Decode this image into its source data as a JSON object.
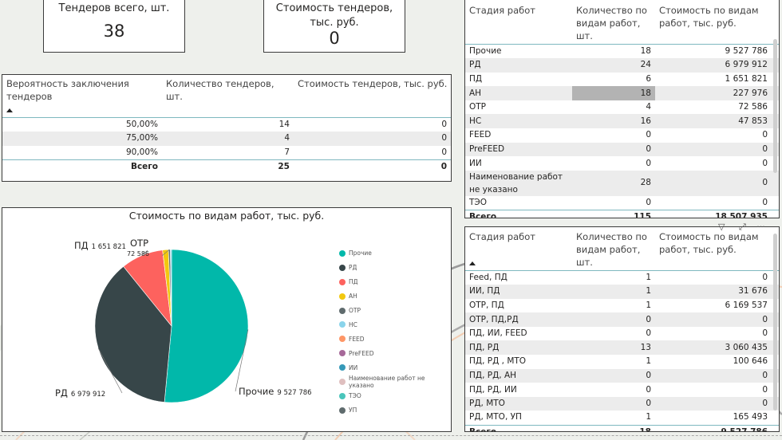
{
  "kpis": {
    "tenders_total": {
      "label": "Тендеров всего, шт.",
      "value": "38"
    },
    "tenders_cost": {
      "label": "Стоимость тендеров, тыс. руб.",
      "value": "0"
    }
  },
  "probability_table": {
    "headers": [
      "Вероятность заключения тендеров",
      "Количество тендеров, шт.",
      "Стоимость тендеров, тыс. руб."
    ],
    "rows": [
      [
        "50,00%",
        "14",
        "0"
      ],
      [
        "75,00%",
        "4",
        "0"
      ],
      [
        "90,00%",
        "7",
        "0"
      ]
    ],
    "total": [
      "Всего",
      "25",
      "0"
    ]
  },
  "stage_table": {
    "headers": [
      "Стадия работ",
      "Количество по видам работ, шт.",
      "Стоимость по видам работ, тыс. руб."
    ],
    "rows": [
      [
        "Прочие",
        "18",
        "9 527 786"
      ],
      [
        "РД",
        "24",
        "6 979 912"
      ],
      [
        "ПД",
        "6",
        "1 651 821"
      ],
      [
        "АН",
        "18",
        "227 976"
      ],
      [
        "ОТР",
        "4",
        "72 586"
      ],
      [
        "НС",
        "16",
        "47 853"
      ],
      [
        "FEED",
        "0",
        "0"
      ],
      [
        "PreFEED",
        "0",
        "0"
      ],
      [
        "ИИ",
        "0",
        "0"
      ],
      [
        "Наименование работ не указано",
        "28",
        "0"
      ],
      [
        "ТЭО",
        "0",
        "0"
      ]
    ],
    "total": [
      "Всего",
      "115",
      "18 507 935"
    ]
  },
  "combo_table": {
    "headers": [
      "Стадия работ",
      "Количество по видам работ, шт.",
      "Стоимость по видам работ, тыс. руб."
    ],
    "rows": [
      [
        "Feed, ПД",
        "1",
        "0"
      ],
      [
        "ИИ, ПД",
        "1",
        "31 676"
      ],
      [
        "ОТР, ПД",
        "1",
        "6 169 537"
      ],
      [
        "ОТР, ПД,РД",
        "0",
        "0"
      ],
      [
        "ПД, ИИ, FEED",
        "0",
        "0"
      ],
      [
        "ПД, РД",
        "13",
        "3 060 435"
      ],
      [
        "ПД, РД , МТО",
        "1",
        "100 646"
      ],
      [
        "ПД, РД, АН",
        "0",
        "0"
      ],
      [
        "ПД, РД, ИИ",
        "0",
        "0"
      ],
      [
        "РД, МТО",
        "0",
        "0"
      ],
      [
        "РД, МТО, УП",
        "1",
        "165 493"
      ]
    ],
    "total": [
      "Всего",
      "18",
      "9 527 786"
    ]
  },
  "chart_data": {
    "type": "pie",
    "title": "Стоимость по видам работ, тыс. руб.",
    "categories": [
      "Прочие",
      "РД",
      "ПД",
      "АН",
      "ОТР",
      "НС",
      "FEED",
      "PreFEED",
      "ИИ",
      "Наименование работ не указано",
      "ТЭО",
      "УП"
    ],
    "values": [
      9527786,
      6979912,
      1651821,
      227976,
      72586,
      47853,
      0,
      0,
      0,
      0,
      0,
      0
    ],
    "colors": [
      "#01b8aa",
      "#374649",
      "#fd625e",
      "#f2c80f",
      "#5f6b6d",
      "#8ad4eb",
      "#fe9666",
      "#a66999",
      "#3599b8",
      "#dfbfbf",
      "#4ac5bb",
      "#5f6b6d"
    ],
    "data_labels": [
      {
        "category": "Прочие",
        "name": "Прочие",
        "value": "9 527 786"
      },
      {
        "category": "РД",
        "name": "РД",
        "value": "6 979 912"
      },
      {
        "category": "ПД",
        "name": "ПД",
        "value": "1 651 821"
      },
      {
        "category": "ОТР",
        "name": "ОТР",
        "value": "72 586"
      }
    ],
    "legend_position": "right"
  },
  "icons": {
    "filter": "filter-icon",
    "focus": "focus-mode-icon",
    "more": "more-options-icon"
  },
  "icon_glyphs": {
    "filter": "▽",
    "focus": "⤢",
    "more": "···"
  }
}
